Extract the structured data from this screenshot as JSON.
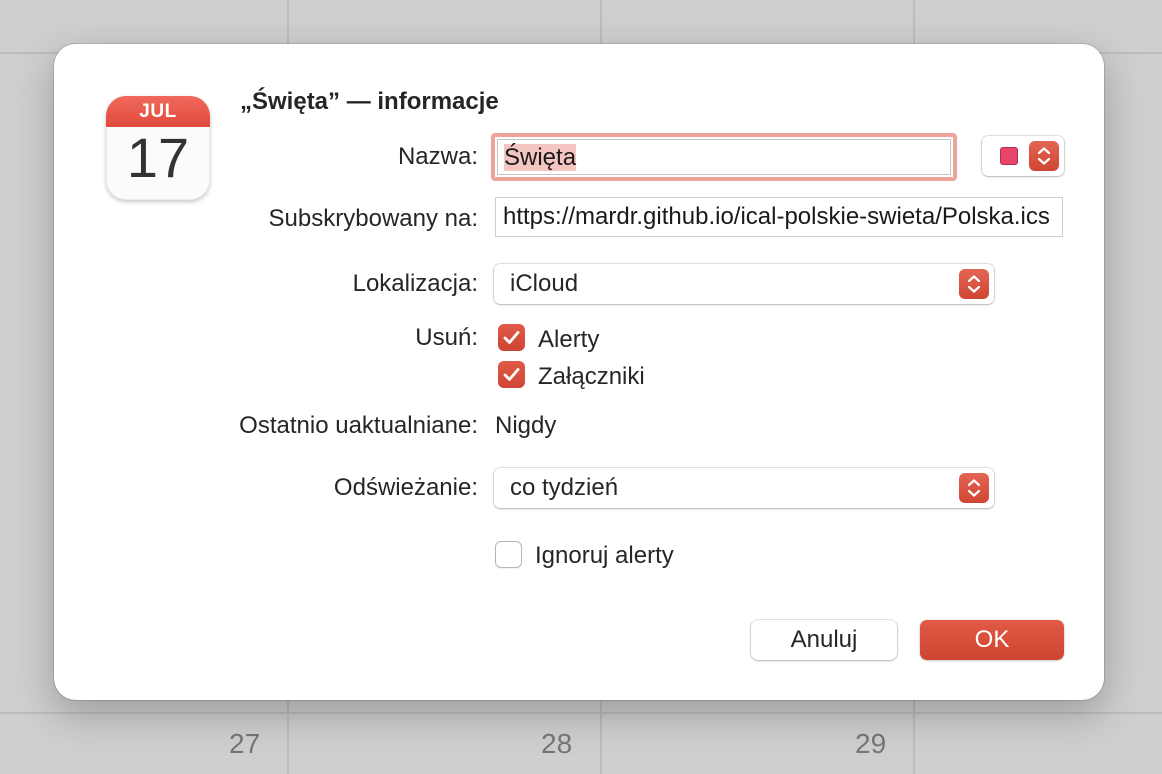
{
  "background": {
    "day_numbers": [
      "27",
      "28",
      "29"
    ]
  },
  "dialog": {
    "title": "„Święta” — informacje",
    "app_icon": {
      "month": "JUL",
      "day": "17"
    },
    "name": {
      "label": "Nazwa:",
      "value": "Święta",
      "color": "#e8436a"
    },
    "subscribed": {
      "label": "Subskrybowany na:",
      "value": "https://mardr.github.io/ical-polskie-swieta/Polska.ics"
    },
    "location": {
      "label": "Lokalizacja:",
      "value": "iCloud"
    },
    "remove": {
      "label": "Usuń:",
      "options": [
        {
          "label": "Alerty",
          "checked": true
        },
        {
          "label": "Załączniki",
          "checked": true
        }
      ]
    },
    "last_updated": {
      "label": "Ostatnio uaktualniane:",
      "value": "Nigdy"
    },
    "refresh": {
      "label": "Odświeżanie:",
      "value": "co tydzień"
    },
    "ignore_alerts": {
      "label": "Ignoruj alerty",
      "checked": false
    },
    "buttons": {
      "cancel": "Anuluj",
      "ok": "OK"
    }
  },
  "colors": {
    "accent": "#d94b38"
  }
}
